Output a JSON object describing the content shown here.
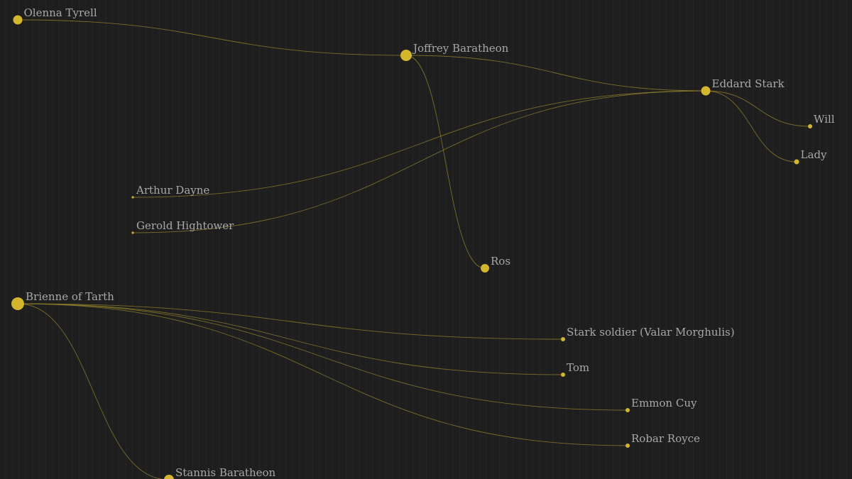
{
  "colors": {
    "background": "#1e1e1e",
    "node": "#d4b52e",
    "edge": "#8a7a2a",
    "label": "#a8a8a8"
  },
  "nodes": [
    {
      "id": "olenna",
      "label": "Olenna Tyrell"
    },
    {
      "id": "joffrey",
      "label": "Joffrey Baratheon"
    },
    {
      "id": "eddard",
      "label": "Eddard Stark"
    },
    {
      "id": "will",
      "label": "Will"
    },
    {
      "id": "lady",
      "label": "Lady"
    },
    {
      "id": "arthur",
      "label": "Arthur Dayne"
    },
    {
      "id": "gerold",
      "label": "Gerold Hightower"
    },
    {
      "id": "ros",
      "label": "Ros"
    },
    {
      "id": "brienne",
      "label": "Brienne of Tarth"
    },
    {
      "id": "stark_soldier",
      "label": "Stark soldier (Valar Morghulis)"
    },
    {
      "id": "tom",
      "label": "Tom"
    },
    {
      "id": "emmon",
      "label": "Emmon Cuy"
    },
    {
      "id": "robar",
      "label": "Robar Royce"
    },
    {
      "id": "stannis",
      "label": "Stannis Baratheon"
    }
  ],
  "edges": [
    [
      "olenna",
      "joffrey"
    ],
    [
      "joffrey",
      "eddard"
    ],
    [
      "joffrey",
      "ros"
    ],
    [
      "eddard",
      "will"
    ],
    [
      "eddard",
      "lady"
    ],
    [
      "arthur",
      "eddard"
    ],
    [
      "gerold",
      "eddard"
    ],
    [
      "brienne",
      "stark_soldier"
    ],
    [
      "brienne",
      "tom"
    ],
    [
      "brienne",
      "emmon"
    ],
    [
      "brienne",
      "robar"
    ],
    [
      "brienne",
      "stannis"
    ]
  ]
}
